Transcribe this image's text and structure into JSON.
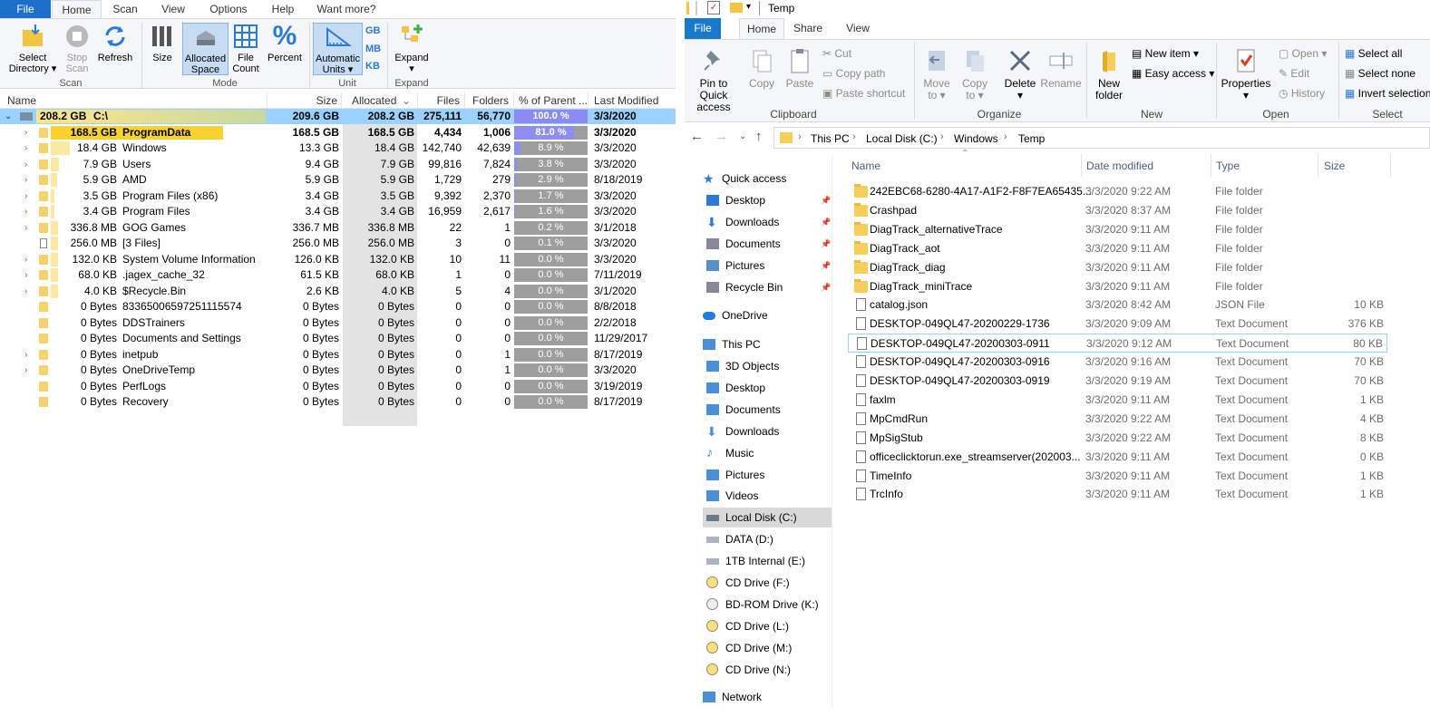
{
  "left_app": {
    "tabs": [
      "File",
      "Home",
      "Scan",
      "View",
      "Options",
      "Help",
      "Want more?"
    ],
    "ribbon": {
      "select_directory": "Select\nDirectory ▾",
      "select_directory_l1": "Select",
      "select_directory_l2": "Directory ▾",
      "stop_scan_l1": "Stop",
      "stop_scan_l2": "Scan",
      "refresh": "Refresh",
      "size": "Size",
      "allocated_l1": "Allocated",
      "allocated_l2": "Space",
      "file_count_l1": "File",
      "file_count_l2": "Count",
      "percent": "Percent",
      "automatic_l1": "Automatic",
      "automatic_l2": "Units ▾",
      "unit_gb": "GB",
      "unit_mb": "MB",
      "unit_kb": "KB",
      "expand": "Expand",
      "group_scan": "Scan",
      "group_mode": "Mode",
      "group_unit": "Unit",
      "group_expand": "Expand"
    },
    "columns": {
      "name": "Name",
      "size": "Size",
      "allocated": "Allocated",
      "files": "Files",
      "folders": "Folders",
      "percent": "% of Parent ...",
      "modified": "Last Modified"
    },
    "rows": [
      {
        "sizelabel": "208.2 GB",
        "name": "C:\\",
        "size": "209.6 GB",
        "alloc": "208.2 GB",
        "files": "275,111",
        "folders": "56,770",
        "pct": "100.0 %",
        "pct_value": 100.0,
        "modified": "3/3/2020"
      },
      {
        "sizelabel": "168.5 GB",
        "name": "ProgramData",
        "size": "168.5 GB",
        "alloc": "168.5 GB",
        "files": "4,434",
        "folders": "1,006",
        "pct": "81.0 %",
        "pct_value": 81.0,
        "modified": "3/3/2020"
      },
      {
        "sizelabel": "18.4 GB",
        "name": "Windows",
        "size": "13.3 GB",
        "alloc": "18.4 GB",
        "files": "142,740",
        "folders": "42,639",
        "pct": "8.9 %",
        "pct_value": 8.9,
        "modified": "3/3/2020"
      },
      {
        "sizelabel": "7.9 GB",
        "name": "Users",
        "size": "9.4 GB",
        "alloc": "7.9 GB",
        "files": "99,816",
        "folders": "7,824",
        "pct": "3.8 %",
        "pct_value": 3.8,
        "modified": "3/3/2020"
      },
      {
        "sizelabel": "5.9 GB",
        "name": "AMD",
        "size": "5.9 GB",
        "alloc": "5.9 GB",
        "files": "1,729",
        "folders": "279",
        "pct": "2.9 %",
        "pct_value": 2.9,
        "modified": "8/18/2019"
      },
      {
        "sizelabel": "3.5 GB",
        "name": "Program Files (x86)",
        "size": "3.4 GB",
        "alloc": "3.5 GB",
        "files": "9,392",
        "folders": "2,370",
        "pct": "1.7 %",
        "pct_value": 1.7,
        "modified": "3/3/2020"
      },
      {
        "sizelabel": "3.4 GB",
        "name": "Program Files",
        "size": "3.4 GB",
        "alloc": "3.4 GB",
        "files": "16,959",
        "folders": "2,617",
        "pct": "1.6 %",
        "pct_value": 1.6,
        "modified": "3/3/2020"
      },
      {
        "sizelabel": "336.8 MB",
        "name": "GOG Games",
        "size": "336.7 MB",
        "alloc": "336.8 MB",
        "files": "22",
        "folders": "1",
        "pct": "0.2 %",
        "pct_value": 0.2,
        "modified": "3/1/2018"
      },
      {
        "sizelabel": "256.0 MB",
        "name": "[3 Files]",
        "size": "256.0 MB",
        "alloc": "256.0 MB",
        "files": "3",
        "folders": "0",
        "pct": "0.1 %",
        "pct_value": 0.1,
        "modified": "3/3/2020"
      },
      {
        "sizelabel": "132.0 KB",
        "name": "System Volume Information",
        "size": "126.0 KB",
        "alloc": "132.0 KB",
        "files": "10",
        "folders": "11",
        "pct": "0.0 %",
        "pct_value": 0.0,
        "modified": "3/3/2020"
      },
      {
        "sizelabel": "68.0 KB",
        "name": ".jagex_cache_32",
        "size": "61.5 KB",
        "alloc": "68.0 KB",
        "files": "1",
        "folders": "0",
        "pct": "0.0 %",
        "pct_value": 0.0,
        "modified": "7/11/2019"
      },
      {
        "sizelabel": "4.0 KB",
        "name": "$Recycle.Bin",
        "size": "2.6 KB",
        "alloc": "4.0 KB",
        "files": "5",
        "folders": "4",
        "pct": "0.0 %",
        "pct_value": 0.0,
        "modified": "3/1/2020"
      },
      {
        "sizelabel": "0 Bytes",
        "name": "83365006597251115574",
        "size": "0 Bytes",
        "alloc": "0 Bytes",
        "files": "0",
        "folders": "0",
        "pct": "0.0 %",
        "pct_value": 0.0,
        "modified": "8/8/2018"
      },
      {
        "sizelabel": "0 Bytes",
        "name": "DDSTrainers",
        "size": "0 Bytes",
        "alloc": "0 Bytes",
        "files": "0",
        "folders": "0",
        "pct": "0.0 %",
        "pct_value": 0.0,
        "modified": "2/2/2018"
      },
      {
        "sizelabel": "0 Bytes",
        "name": "Documents and Settings",
        "size": "0 Bytes",
        "alloc": "0 Bytes",
        "files": "0",
        "folders": "0",
        "pct": "0.0 %",
        "pct_value": 0.0,
        "modified": "11/29/2017"
      },
      {
        "sizelabel": "0 Bytes",
        "name": "inetpub",
        "size": "0 Bytes",
        "alloc": "0 Bytes",
        "files": "0",
        "folders": "1",
        "pct": "0.0 %",
        "pct_value": 0.0,
        "modified": "8/17/2019"
      },
      {
        "sizelabel": "0 Bytes",
        "name": "OneDriveTemp",
        "size": "0 Bytes",
        "alloc": "0 Bytes",
        "files": "0",
        "folders": "1",
        "pct": "0.0 %",
        "pct_value": 0.0,
        "modified": "3/3/2020"
      },
      {
        "sizelabel": "0 Bytes",
        "name": "PerfLogs",
        "size": "0 Bytes",
        "alloc": "0 Bytes",
        "files": "0",
        "folders": "0",
        "pct": "0.0 %",
        "pct_value": 0.0,
        "modified": "3/19/2019"
      },
      {
        "sizelabel": "0 Bytes",
        "name": "Recovery",
        "size": "0 Bytes",
        "alloc": "0 Bytes",
        "files": "0",
        "folders": "0",
        "pct": "0.0 %",
        "pct_value": 0.0,
        "modified": "8/17/2019"
      }
    ]
  },
  "right_app": {
    "title": "Temp",
    "tabs": [
      "File",
      "Home",
      "Share",
      "View"
    ],
    "ribbon": {
      "pin_l1": "Pin to Quick",
      "pin_l2": "access",
      "copy": "Copy",
      "paste": "Paste",
      "cut": "Cut",
      "copy_path": "Copy path",
      "paste_shortcut": "Paste shortcut",
      "move_l1": "Move",
      "move_l2": "to ▾",
      "copy_to_l1": "Copy",
      "copy_to_l2": "to ▾",
      "delete": "Delete",
      "delete_arrow": "▾",
      "rename": "Rename",
      "new_folder_l1": "New",
      "new_folder_l2": "folder",
      "new_item": "New item ▾",
      "easy_access": "Easy access ▾",
      "properties": "Properties",
      "properties_arrow": "▾",
      "open": "Open ▾",
      "edit": "Edit",
      "history": "History",
      "select_all": "Select all",
      "select_none": "Select none",
      "invert_selection": "Invert selection",
      "group_clipboard": "Clipboard",
      "group_organize": "Organize",
      "group_new": "New",
      "group_open": "Open",
      "group_select": "Select"
    },
    "breadcrumb": [
      "This PC",
      "Local Disk (C:)",
      "Windows",
      "Temp"
    ],
    "nav": {
      "quick_access": "Quick access",
      "quick_items": [
        "Desktop",
        "Downloads",
        "Documents",
        "Pictures",
        "Recycle Bin"
      ],
      "onedrive": "OneDrive",
      "this_pc": "This PC",
      "pc_items": [
        "3D Objects",
        "Desktop",
        "Documents",
        "Downloads",
        "Music",
        "Pictures",
        "Videos",
        "Local Disk (C:)",
        "DATA (D:)",
        "1TB Internal (E:)",
        "CD Drive (F:)",
        "BD-ROM Drive (K:)",
        "CD Drive (L:)",
        "CD Drive (M:)",
        "CD Drive (N:)"
      ],
      "network": "Network"
    },
    "columns": {
      "name": "Name",
      "modified": "Date modified",
      "type": "Type",
      "size": "Size"
    },
    "files": [
      {
        "name": "242EBC68-6280-4A17-A1F2-F8F7EA65435...",
        "modified": "3/3/2020 9:22 AM",
        "type": "File folder",
        "size": "",
        "folder": true
      },
      {
        "name": "Crashpad",
        "modified": "3/3/2020 8:37 AM",
        "type": "File folder",
        "size": "",
        "folder": true
      },
      {
        "name": "DiagTrack_alternativeTrace",
        "modified": "3/3/2020 9:11 AM",
        "type": "File folder",
        "size": "",
        "folder": true
      },
      {
        "name": "DiagTrack_aot",
        "modified": "3/3/2020 9:11 AM",
        "type": "File folder",
        "size": "",
        "folder": true
      },
      {
        "name": "DiagTrack_diag",
        "modified": "3/3/2020 9:11 AM",
        "type": "File folder",
        "size": "",
        "folder": true
      },
      {
        "name": "DiagTrack_miniTrace",
        "modified": "3/3/2020 9:11 AM",
        "type": "File folder",
        "size": "",
        "folder": true
      },
      {
        "name": "catalog.json",
        "modified": "3/3/2020 8:42 AM",
        "type": "JSON File",
        "size": "10 KB",
        "folder": false
      },
      {
        "name": "DESKTOP-049QL47-20200229-1736",
        "modified": "3/3/2020 9:09 AM",
        "type": "Text Document",
        "size": "376 KB",
        "folder": false
      },
      {
        "name": "DESKTOP-049QL47-20200303-0911",
        "modified": "3/3/2020 9:12 AM",
        "type": "Text Document",
        "size": "80 KB",
        "folder": false
      },
      {
        "name": "DESKTOP-049QL47-20200303-0916",
        "modified": "3/3/2020 9:16 AM",
        "type": "Text Document",
        "size": "70 KB",
        "folder": false
      },
      {
        "name": "DESKTOP-049QL47-20200303-0919",
        "modified": "3/3/2020 9:19 AM",
        "type": "Text Document",
        "size": "70 KB",
        "folder": false
      },
      {
        "name": "faxlm",
        "modified": "3/3/2020 9:11 AM",
        "type": "Text Document",
        "size": "1 KB",
        "folder": false
      },
      {
        "name": "MpCmdRun",
        "modified": "3/3/2020 9:22 AM",
        "type": "Text Document",
        "size": "4 KB",
        "folder": false
      },
      {
        "name": "MpSigStub",
        "modified": "3/3/2020 9:22 AM",
        "type": "Text Document",
        "size": "8 KB",
        "folder": false
      },
      {
        "name": "officeclicktorun.exe_streamserver(202003...",
        "modified": "3/3/2020 9:11 AM",
        "type": "Text Document",
        "size": "0 KB",
        "folder": false
      },
      {
        "name": "TimeInfo",
        "modified": "3/3/2020 9:11 AM",
        "type": "Text Document",
        "size": "1 KB",
        "folder": false
      },
      {
        "name": "TrcInfo",
        "modified": "3/3/2020 9:11 AM",
        "type": "Text Document",
        "size": "1 KB",
        "folder": false
      }
    ]
  },
  "colors": {
    "file_tab_left": "#1e6fc9",
    "file_tab_right": "#1979ca",
    "selected_row": "#99d1ff",
    "percent_fill": "#8e8ef0",
    "percent_bg": "#9e9e9e",
    "folder": "#f6cf5a",
    "size_bar": "#fbe9a1",
    "programdata_bar": "#f7d230"
  }
}
